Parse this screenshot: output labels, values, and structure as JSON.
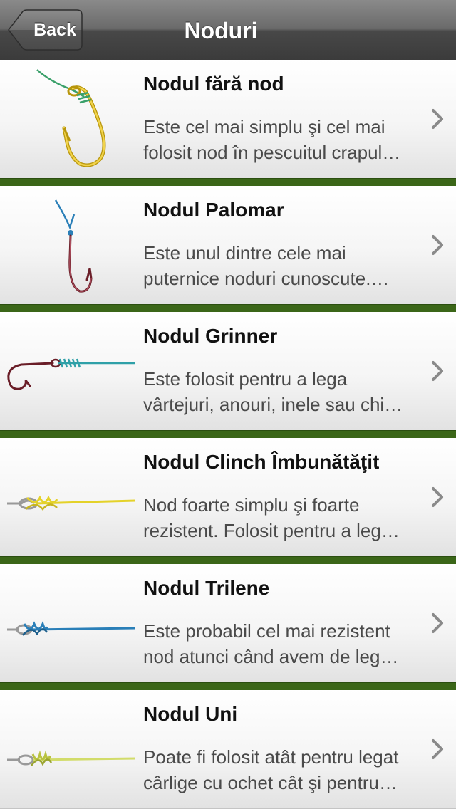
{
  "navbar": {
    "back_label": "Back",
    "title": "Noduri"
  },
  "knots": [
    {
      "title": "Nodul fără nod",
      "desc_line1": "Este cel mai simplu şi cel mai",
      "desc_line2": "folosit nod în pescuitul crapul…",
      "icon": "knotless-knot-hook-icon"
    },
    {
      "title": "Nodul Palomar",
      "desc_line1": "Este unul dintre cele mai",
      "desc_line2": "puternice noduri cunoscute.…",
      "icon": "palomar-knot-hook-icon"
    },
    {
      "title": "Nodul Grinner",
      "desc_line1": "Este folosit pentru a lega",
      "desc_line2": "vârtejuri, anouri, inele sau chi…",
      "icon": "grinner-knot-hook-icon"
    },
    {
      "title": "Nodul Clinch Îmbunătăţit",
      "desc_line1": "Nod foarte simplu şi foarte",
      "desc_line2": "rezistent. Folosit pentru a leg…",
      "icon": "improved-clinch-knot-icon"
    },
    {
      "title": "Nodul Trilene",
      "desc_line1": "Este probabil cel mai rezistent",
      "desc_line2": "nod atunci când avem de leg…",
      "icon": "trilene-knot-icon"
    },
    {
      "title": "Nodul Uni",
      "desc_line1": "Poate fi folosit atât pentru legat",
      "desc_line2": "cârlige cu ochet cât şi pentru…",
      "icon": "uni-knot-icon"
    }
  ],
  "colors": {
    "separator": "#3b6618",
    "chevron": "#8a8a8a"
  }
}
